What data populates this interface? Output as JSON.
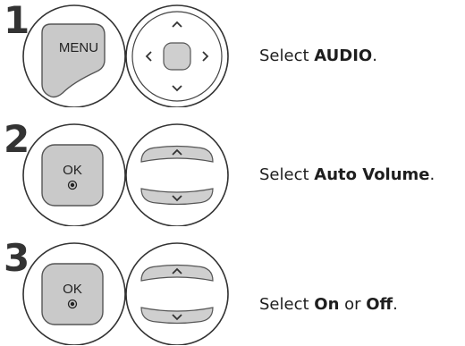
{
  "steps": [
    {
      "number": "1",
      "button_label": "MENU",
      "caption_prefix": "Select ",
      "caption_bold": "AUDIO",
      "caption_suffix": "."
    },
    {
      "number": "2",
      "button_label": "OK",
      "caption_prefix": "Select ",
      "caption_bold": "Auto Volume",
      "caption_suffix": "."
    },
    {
      "number": "3",
      "button_label": "OK",
      "caption_prefix": "Select ",
      "caption_bold": "On",
      "caption_middle": " or ",
      "caption_bold2": "Off",
      "caption_suffix": "."
    }
  ]
}
